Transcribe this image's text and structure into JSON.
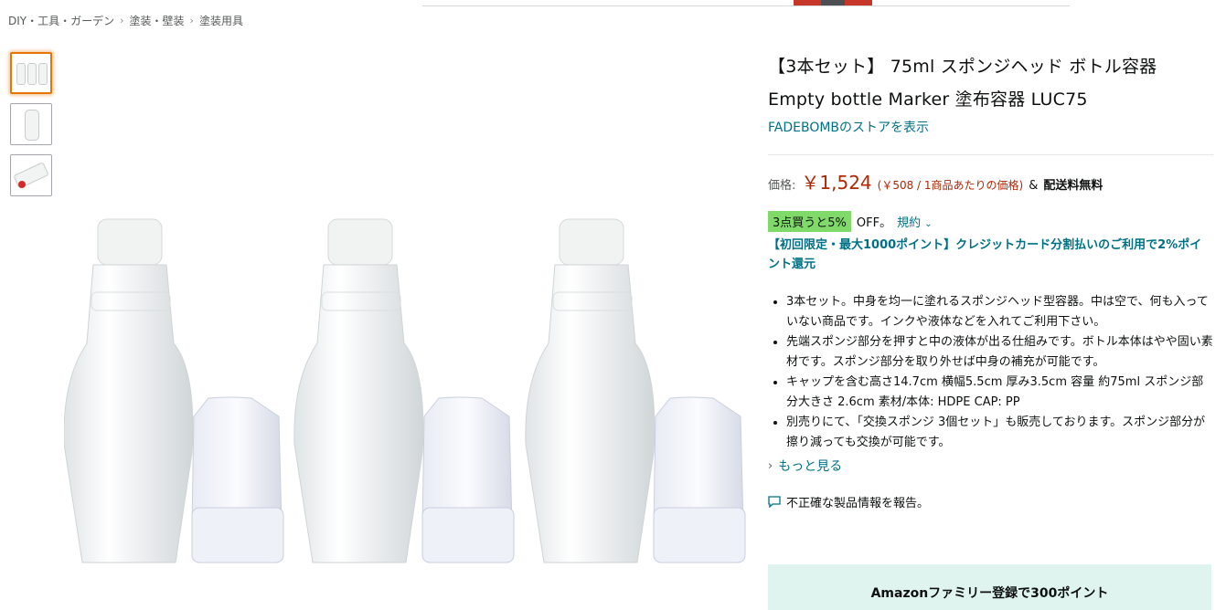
{
  "breadcrumb": [
    "DIY・工具・ガーデン",
    "塗装・壁装",
    "塗装用具"
  ],
  "product": {
    "title_line1": "【3本セット】 75ml スポンジヘッド ボトル容器",
    "title_line2": "Empty bottle Marker 塗布容器 LUC75",
    "store_link": "FADEBOMBのストアを表示"
  },
  "price": {
    "label": "価格:",
    "amount": "￥1,524",
    "unit": "(￥508 / 1商品あたりの価格)",
    "amp": "&",
    "shipping": "配送料無料"
  },
  "promo": {
    "badge": "3点買うと5%",
    "off": "OFF。",
    "terms": "規約"
  },
  "points_text": "【初回限定・最大1000ポイント】クレジットカード分割払いのご利用で2%ポイント還元",
  "bullets": [
    "3本セット。中身を均一に塗れるスポンジヘッド型容器。中は空で、何も入っていない商品です。インクや液体などを入れてご利用下さい。",
    "先端スポンジ部分を押すと中の液体が出る仕組みです。ボトル本体はやや固い素材です。スポンジ部分を取り外せば中身の補充が可能です。",
    "キャップを含む高さ14.7cm 横幅5.5cm 厚み3.5cm 容量 約75ml スポンジ部分大きさ 2.6cm 素材/本体: HDPE CAP: PP",
    "別売りにて、「交換スポンジ 3個セット」も販売しております。スポンジ部分が擦り減っても交換が可能です。"
  ],
  "more_link": "もっと見る",
  "report_link": "不正確な製品情報を報告。",
  "family_banner": "Amazonファミリー登録で300ポイント",
  "colors": {
    "link": "#007185",
    "price": "#b12704",
    "badge": "#7fda69",
    "selected_thumb": "#e77600"
  },
  "icons": {
    "breadcrumb_sep": "chevron-right-icon",
    "terms": "chevron-down-icon",
    "more": "chevron-right-icon",
    "report": "comment-icon"
  }
}
